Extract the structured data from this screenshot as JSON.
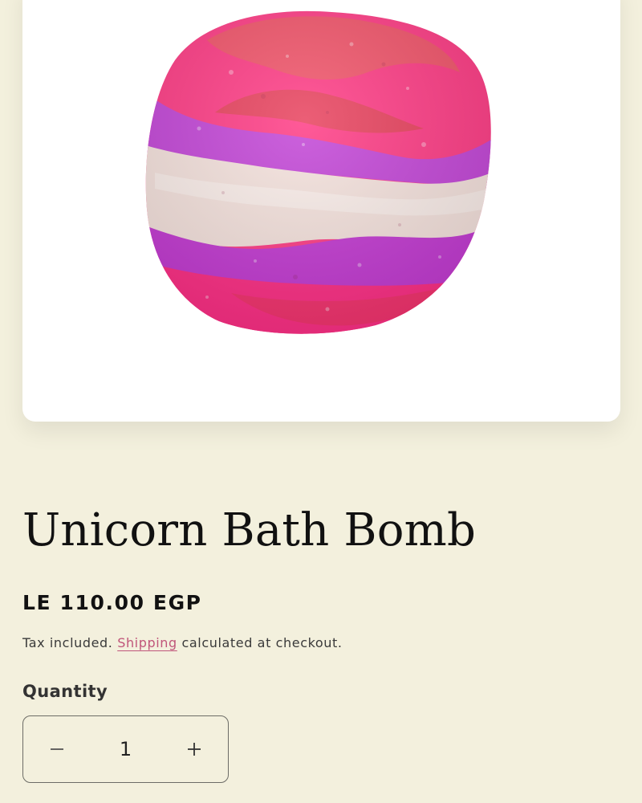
{
  "product": {
    "image_icon": "bath-bomb-image",
    "title": "Unicorn Bath Bomb",
    "price": "LE 110.00 EGP",
    "tax_note_prefix": "Tax included.",
    "shipping_link": "Shipping",
    "tax_note_suffix": "calculated at checkout."
  },
  "quantity": {
    "label": "Quantity",
    "value": "1",
    "decrement_icon": "minus-icon",
    "increment_icon": "plus-icon"
  },
  "colors": {
    "background": "#f3f0dd",
    "link": "#c0567a",
    "bath_bomb_pink": "#ff2f86",
    "bath_bomb_purple": "#c93fdc",
    "bath_bomb_cream": "#f7e6e0"
  }
}
